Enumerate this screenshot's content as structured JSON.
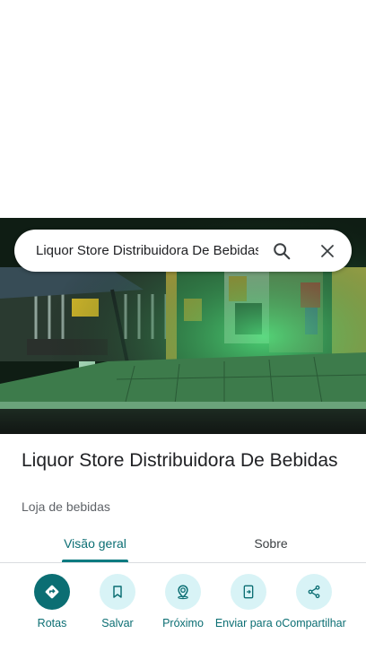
{
  "search": {
    "value": "Liquor Store Distribuidora De Bebidas",
    "search_icon": "search-icon",
    "close_icon": "close-icon"
  },
  "place": {
    "title": "Liquor Store Distribuidora De Bebidas",
    "category": "Loja de bebidas"
  },
  "tabs": [
    {
      "label": "Visão geral",
      "active": true
    },
    {
      "label": "Sobre",
      "active": false
    }
  ],
  "actions": [
    {
      "label": "Rotas",
      "icon": "directions-icon"
    },
    {
      "label": "Salvar",
      "icon": "bookmark-icon"
    },
    {
      "label": "Próximo",
      "icon": "nearby-icon"
    },
    {
      "label": "Enviar para o",
      "icon": "send-to-phone-icon"
    },
    {
      "label": "Compartilhar",
      "icon": "share-icon"
    }
  ],
  "colors": {
    "accent": "#0b6e73",
    "action_bg": "#d8f3f6",
    "store_green": "#3fd86a"
  }
}
